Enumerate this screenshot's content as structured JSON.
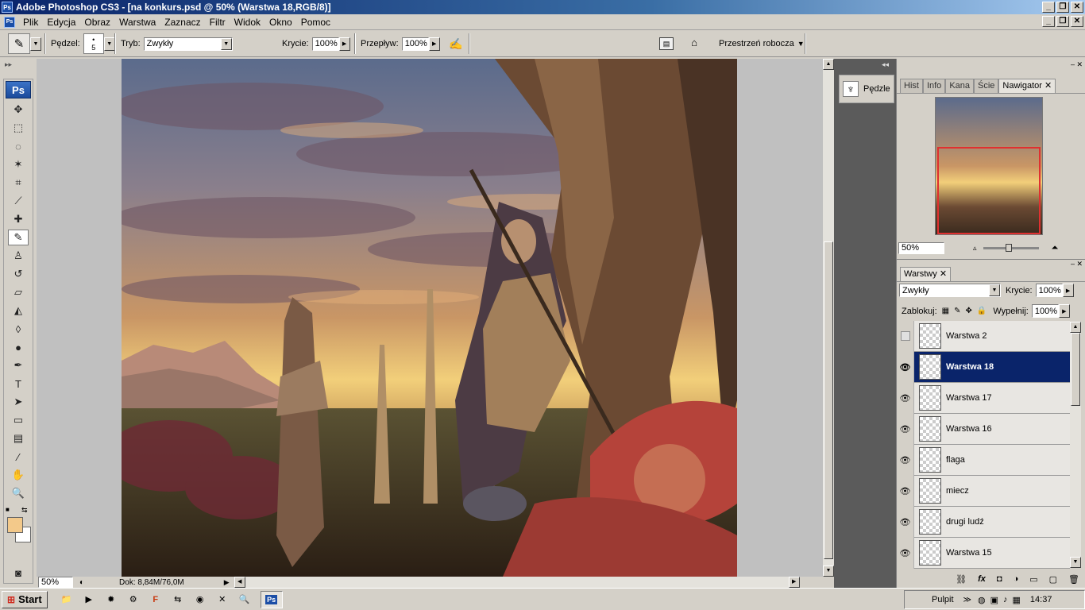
{
  "window": {
    "title": "Adobe Photoshop CS3 - [na konkurs.psd @ 50% (Warstwa 18,RGB/8)]",
    "app_icon": "Ps",
    "buttons": [
      "_",
      "❐",
      "✕"
    ]
  },
  "menubar": {
    "items": [
      "Plik",
      "Edycja",
      "Obraz",
      "Warstwa",
      "Zaznacz",
      "Filtr",
      "Widok",
      "Okno",
      "Pomoc"
    ]
  },
  "options": {
    "brush_label": "Pędzel:",
    "brush_size": "5",
    "mode_label": "Tryb:",
    "mode_value": "Zwykły",
    "opacity_label": "Krycie:",
    "opacity_value": "100%",
    "flow_label": "Przepływ:",
    "flow_value": "100%",
    "workspace_label": "Przestrzeń robocza"
  },
  "toolbox": {
    "logo": "Ps",
    "tools": [
      {
        "name": "move-tool-icon",
        "glyph": "✥"
      },
      {
        "name": "marquee-tool-icon",
        "glyph": "⬚"
      },
      {
        "name": "lasso-tool-icon",
        "glyph": "◌"
      },
      {
        "name": "magic-wand-icon",
        "glyph": "✶"
      },
      {
        "name": "crop-tool-icon",
        "glyph": "⌗"
      },
      {
        "name": "eyedropper-tool-icon",
        "glyph": "⟋"
      },
      {
        "name": "healing-brush-icon",
        "glyph": "✚"
      },
      {
        "name": "brush-tool-icon",
        "glyph": "✎"
      },
      {
        "name": "clone-stamp-icon",
        "glyph": "♙"
      },
      {
        "name": "history-brush-icon",
        "glyph": "↺"
      },
      {
        "name": "eraser-tool-icon",
        "glyph": "▱"
      },
      {
        "name": "paint-bucket-icon",
        "glyph": "◭"
      },
      {
        "name": "blur-tool-icon",
        "glyph": "◊"
      },
      {
        "name": "dodge-tool-icon",
        "glyph": "●"
      },
      {
        "name": "pen-tool-icon",
        "glyph": "✒"
      },
      {
        "name": "type-tool-icon",
        "glyph": "T"
      },
      {
        "name": "path-select-icon",
        "glyph": "➤"
      },
      {
        "name": "shape-tool-icon",
        "glyph": "▭"
      },
      {
        "name": "notes-tool-icon",
        "glyph": "▤"
      },
      {
        "name": "eyedropper-icon",
        "glyph": "⁄"
      },
      {
        "name": "hand-tool-icon",
        "glyph": "✋"
      },
      {
        "name": "zoom-tool-icon",
        "glyph": "🔍"
      }
    ],
    "active_index": 7,
    "foreground_color": "#f3c98a",
    "background_color": "#ffffff"
  },
  "status": {
    "zoom": "50%",
    "doc": "Dok: 8,84M/76,0M"
  },
  "brushes_panel": {
    "label": "Pędzle"
  },
  "navigator": {
    "tabs": [
      "Hist",
      "Info",
      "Kana",
      "Ście",
      "Nawigator"
    ],
    "active_tab": "Nawigator",
    "zoom": "50%"
  },
  "layers_panel": {
    "tab": "Warstwy",
    "blend_mode": "Zwykły",
    "opacity_label": "Krycie:",
    "opacity_value": "100%",
    "lock_label": "Zablokuj:",
    "fill_label": "Wypełnij:",
    "fill_value": "100%",
    "layers": [
      {
        "name": "Warstwa 2",
        "visible": false,
        "selected": false
      },
      {
        "name": "Warstwa 18",
        "visible": true,
        "selected": true
      },
      {
        "name": "Warstwa 17",
        "visible": true,
        "selected": false
      },
      {
        "name": "Warstwa 16",
        "visible": true,
        "selected": false
      },
      {
        "name": "flaga",
        "visible": true,
        "selected": false
      },
      {
        "name": "miecz",
        "visible": true,
        "selected": false
      },
      {
        "name": "drugi ludź",
        "visible": true,
        "selected": false
      },
      {
        "name": "Warstwa 15",
        "visible": true,
        "selected": false
      }
    ]
  },
  "taskbar": {
    "start_label": "Start",
    "desktop_label": "Pulpit",
    "clock": "14:37",
    "active_task": "Ps"
  },
  "colors": {
    "selection": "#0a246a",
    "chrome": "#d4d0c8",
    "dock_dark": "#5b5b5b"
  }
}
